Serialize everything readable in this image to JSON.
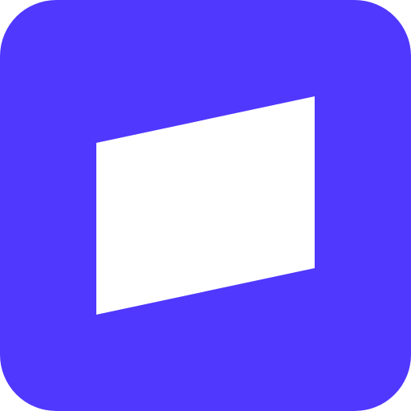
{
  "icon": {
    "name": "app-icon",
    "background_color": "#5038FF",
    "shape_color": "#FFFFFF",
    "shape_icon": "slanted-panel-icon"
  }
}
